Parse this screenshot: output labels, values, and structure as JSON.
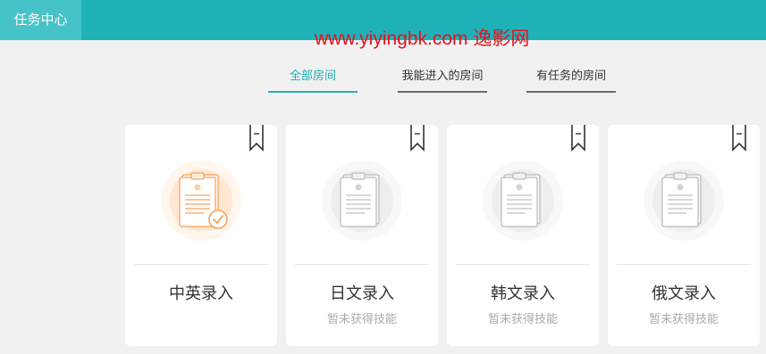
{
  "header": {
    "title": "任务中心"
  },
  "watermark": "www.yiyingbk.com 逸影网",
  "tabs": [
    {
      "label": "全部房间",
      "active": true
    },
    {
      "label": "我能进入的房间",
      "active": false
    },
    {
      "label": "有任务的房间",
      "active": false
    }
  ],
  "rooms": [
    {
      "name": "中英录入",
      "status": "",
      "icon": "clipboard-check-icon",
      "state": "active"
    },
    {
      "name": "日文录入",
      "status": "暂未获得技能",
      "icon": "clipboard-icon",
      "state": "locked"
    },
    {
      "name": "韩文录入",
      "status": "暂未获得技能",
      "icon": "clipboard-icon",
      "state": "locked"
    },
    {
      "name": "俄文录入",
      "status": "暂未获得技能",
      "icon": "clipboard-icon",
      "state": "locked"
    }
  ],
  "colors": {
    "brand": "#1fb1b8",
    "active_icon": "#f5a05a",
    "inactive_icon": "#bbbbbb",
    "watermark": "#e8111a"
  }
}
